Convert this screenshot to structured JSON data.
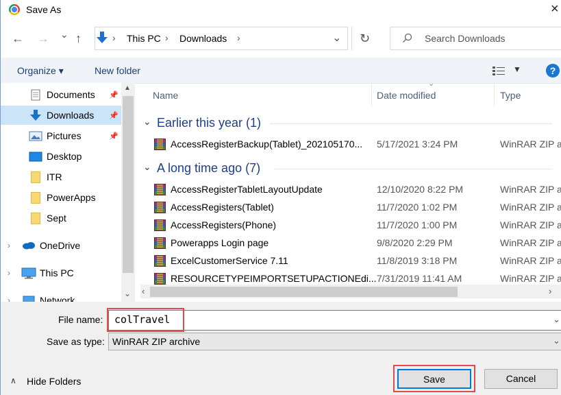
{
  "window": {
    "title": "Save As",
    "close": "×"
  },
  "nav": {
    "back": "←",
    "forward": "→",
    "recent": "⌄",
    "up": "↑",
    "path": [
      "This PC",
      "Downloads"
    ],
    "refresh": "↻",
    "search_placeholder": "Search Downloads"
  },
  "toolbar": {
    "organize": "Organize ▾",
    "new_folder": "New folder",
    "help": "?"
  },
  "sidebar": {
    "items": [
      {
        "label": "Documents"
      },
      {
        "label": "Downloads"
      },
      {
        "label": "Pictures"
      },
      {
        "label": "Desktop"
      },
      {
        "label": "ITR"
      },
      {
        "label": "PowerApps"
      },
      {
        "label": "Sept"
      },
      {
        "label": "OneDrive"
      },
      {
        "label": "This PC"
      },
      {
        "label": "Network"
      }
    ]
  },
  "columns": {
    "name": "Name",
    "date": "Date modified",
    "type": "Type"
  },
  "groups": [
    {
      "title": "Earlier this year (1)",
      "files": [
        {
          "name": "AccessRegisterBackup(Tablet)_202105170...",
          "date": "5/17/2021 3:24 PM",
          "type": "WinRAR ZIP a"
        }
      ]
    },
    {
      "title": "A long time ago (7)",
      "files": [
        {
          "name": "AccessRegisterTabletLayoutUpdate",
          "date": "12/10/2020 8:22 PM",
          "type": "WinRAR ZIP a"
        },
        {
          "name": "AccessRegisters(Tablet)",
          "date": "11/7/2020 1:02 PM",
          "type": "WinRAR ZIP a"
        },
        {
          "name": "AccessRegisters(Phone)",
          "date": "11/7/2020 1:00 PM",
          "type": "WinRAR ZIP a"
        },
        {
          "name": "Powerapps Login page",
          "date": "9/8/2020 2:29 PM",
          "type": "WinRAR ZIP a"
        },
        {
          "name": "ExcelCustomerService 7.11",
          "date": "11/8/2019 3:18 PM",
          "type": "WinRAR ZIP a"
        },
        {
          "name": "RESOURCETYPEIMPORTSETUPACTIONEdi...",
          "date": "7/31/2019 11:41 AM",
          "type": "WinRAR ZIP a"
        }
      ]
    }
  ],
  "form": {
    "file_name_label": "File name:",
    "file_name_value": "colTravel",
    "save_type_label": "Save as type:",
    "save_type_value": "WinRAR ZIP archive"
  },
  "footer": {
    "hide_folders": "Hide Folders",
    "save": "Save",
    "cancel": "Cancel"
  },
  "colors": {
    "highlight": "#e44a4a",
    "accent": "#0078d7",
    "group_title": "#1e3f87"
  }
}
